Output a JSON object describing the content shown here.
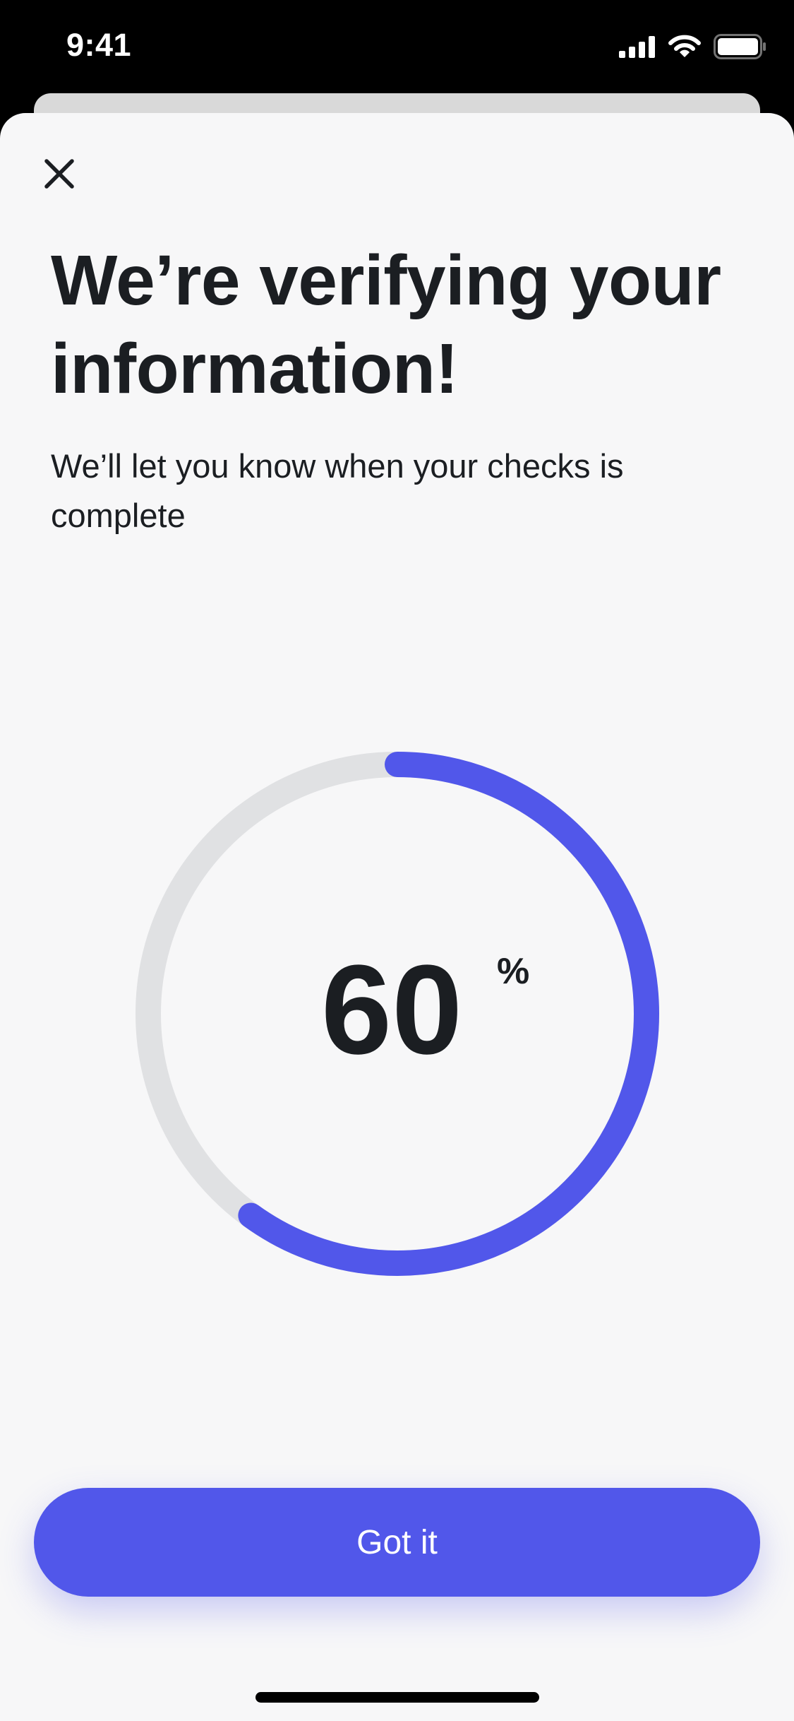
{
  "status_bar": {
    "time": "9:41",
    "icons": [
      "cellular-signal-icon",
      "wifi-icon",
      "battery-icon"
    ]
  },
  "header": {
    "close_icon": "close-icon",
    "title": "We’re verifying your information!",
    "subtitle": "We’ll let you know when your checks is complete"
  },
  "progress": {
    "value": "60",
    "unit": "%",
    "fraction": 0.6,
    "track_color": "#e0e1e3",
    "fill_color": "#5157ea"
  },
  "actions": {
    "primary_label": "Got it",
    "primary_color": "#5157ea"
  }
}
